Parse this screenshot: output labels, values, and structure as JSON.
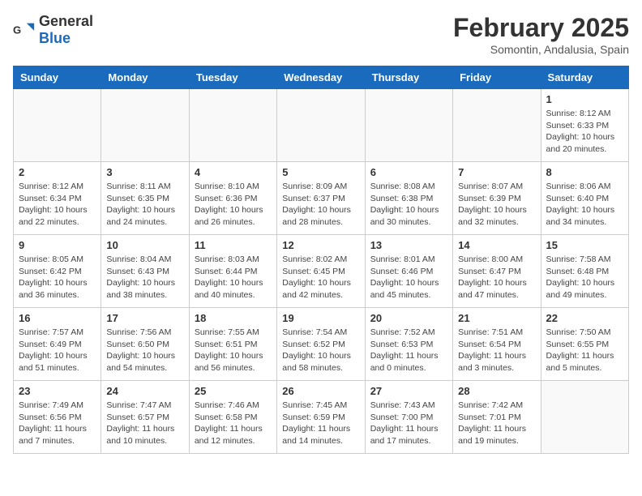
{
  "logo": {
    "general": "General",
    "blue": "Blue"
  },
  "title": {
    "month": "February 2025",
    "location": "Somontin, Andalusia, Spain"
  },
  "weekdays": [
    "Sunday",
    "Monday",
    "Tuesday",
    "Wednesday",
    "Thursday",
    "Friday",
    "Saturday"
  ],
  "weeks": [
    [
      {
        "day": "",
        "info": ""
      },
      {
        "day": "",
        "info": ""
      },
      {
        "day": "",
        "info": ""
      },
      {
        "day": "",
        "info": ""
      },
      {
        "day": "",
        "info": ""
      },
      {
        "day": "",
        "info": ""
      },
      {
        "day": "1",
        "info": "Sunrise: 8:12 AM\nSunset: 6:33 PM\nDaylight: 10 hours\nand 20 minutes."
      }
    ],
    [
      {
        "day": "2",
        "info": "Sunrise: 8:12 AM\nSunset: 6:34 PM\nDaylight: 10 hours\nand 22 minutes."
      },
      {
        "day": "3",
        "info": "Sunrise: 8:11 AM\nSunset: 6:35 PM\nDaylight: 10 hours\nand 24 minutes."
      },
      {
        "day": "4",
        "info": "Sunrise: 8:10 AM\nSunset: 6:36 PM\nDaylight: 10 hours\nand 26 minutes."
      },
      {
        "day": "5",
        "info": "Sunrise: 8:09 AM\nSunset: 6:37 PM\nDaylight: 10 hours\nand 28 minutes."
      },
      {
        "day": "6",
        "info": "Sunrise: 8:08 AM\nSunset: 6:38 PM\nDaylight: 10 hours\nand 30 minutes."
      },
      {
        "day": "7",
        "info": "Sunrise: 8:07 AM\nSunset: 6:39 PM\nDaylight: 10 hours\nand 32 minutes."
      },
      {
        "day": "8",
        "info": "Sunrise: 8:06 AM\nSunset: 6:40 PM\nDaylight: 10 hours\nand 34 minutes."
      }
    ],
    [
      {
        "day": "9",
        "info": "Sunrise: 8:05 AM\nSunset: 6:42 PM\nDaylight: 10 hours\nand 36 minutes."
      },
      {
        "day": "10",
        "info": "Sunrise: 8:04 AM\nSunset: 6:43 PM\nDaylight: 10 hours\nand 38 minutes."
      },
      {
        "day": "11",
        "info": "Sunrise: 8:03 AM\nSunset: 6:44 PM\nDaylight: 10 hours\nand 40 minutes."
      },
      {
        "day": "12",
        "info": "Sunrise: 8:02 AM\nSunset: 6:45 PM\nDaylight: 10 hours\nand 42 minutes."
      },
      {
        "day": "13",
        "info": "Sunrise: 8:01 AM\nSunset: 6:46 PM\nDaylight: 10 hours\nand 45 minutes."
      },
      {
        "day": "14",
        "info": "Sunrise: 8:00 AM\nSunset: 6:47 PM\nDaylight: 10 hours\nand 47 minutes."
      },
      {
        "day": "15",
        "info": "Sunrise: 7:58 AM\nSunset: 6:48 PM\nDaylight: 10 hours\nand 49 minutes."
      }
    ],
    [
      {
        "day": "16",
        "info": "Sunrise: 7:57 AM\nSunset: 6:49 PM\nDaylight: 10 hours\nand 51 minutes."
      },
      {
        "day": "17",
        "info": "Sunrise: 7:56 AM\nSunset: 6:50 PM\nDaylight: 10 hours\nand 54 minutes."
      },
      {
        "day": "18",
        "info": "Sunrise: 7:55 AM\nSunset: 6:51 PM\nDaylight: 10 hours\nand 56 minutes."
      },
      {
        "day": "19",
        "info": "Sunrise: 7:54 AM\nSunset: 6:52 PM\nDaylight: 10 hours\nand 58 minutes."
      },
      {
        "day": "20",
        "info": "Sunrise: 7:52 AM\nSunset: 6:53 PM\nDaylight: 11 hours\nand 0 minutes."
      },
      {
        "day": "21",
        "info": "Sunrise: 7:51 AM\nSunset: 6:54 PM\nDaylight: 11 hours\nand 3 minutes."
      },
      {
        "day": "22",
        "info": "Sunrise: 7:50 AM\nSunset: 6:55 PM\nDaylight: 11 hours\nand 5 minutes."
      }
    ],
    [
      {
        "day": "23",
        "info": "Sunrise: 7:49 AM\nSunset: 6:56 PM\nDaylight: 11 hours\nand 7 minutes."
      },
      {
        "day": "24",
        "info": "Sunrise: 7:47 AM\nSunset: 6:57 PM\nDaylight: 11 hours\nand 10 minutes."
      },
      {
        "day": "25",
        "info": "Sunrise: 7:46 AM\nSunset: 6:58 PM\nDaylight: 11 hours\nand 12 minutes."
      },
      {
        "day": "26",
        "info": "Sunrise: 7:45 AM\nSunset: 6:59 PM\nDaylight: 11 hours\nand 14 minutes."
      },
      {
        "day": "27",
        "info": "Sunrise: 7:43 AM\nSunset: 7:00 PM\nDaylight: 11 hours\nand 17 minutes."
      },
      {
        "day": "28",
        "info": "Sunrise: 7:42 AM\nSunset: 7:01 PM\nDaylight: 11 hours\nand 19 minutes."
      },
      {
        "day": "",
        "info": ""
      }
    ]
  ]
}
